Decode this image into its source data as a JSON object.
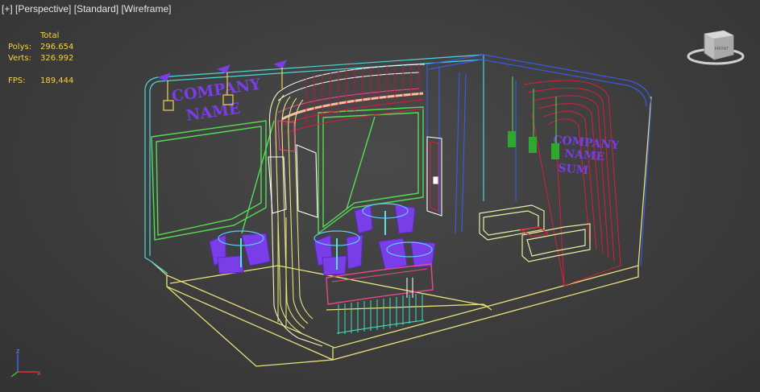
{
  "viewport": {
    "label_plus": "[+]",
    "label_view": "[Perspective]",
    "label_shading": "[Standard]",
    "label_mode": "[Wireframe]"
  },
  "stats": {
    "header": "Total",
    "polys_label": "Polys:",
    "polys_value": "296.654",
    "verts_label": "Verts:",
    "verts_value": "326.992",
    "fps_label": "FPS:",
    "fps_value": "189,444"
  },
  "scene": {
    "logo_line1": "COMPANY",
    "logo_line2": "NAME",
    "logo2_line1": "COMPANY",
    "logo2_line2": "NAME",
    "logo2_line3": "SUM"
  },
  "viewcube": {
    "face_label": "FRONT"
  },
  "axis": {
    "x": "x",
    "z": "z"
  },
  "colors": {
    "yellow": "#f5e27a",
    "green": "#5ee05e",
    "cyan": "#5fe0e0",
    "purple": "#7a3ee8",
    "red": "#d81e3a",
    "pink": "#e84a8a",
    "blue": "#3a5ae0",
    "lime": "#e8f0a0",
    "teal": "#40e0c0"
  }
}
